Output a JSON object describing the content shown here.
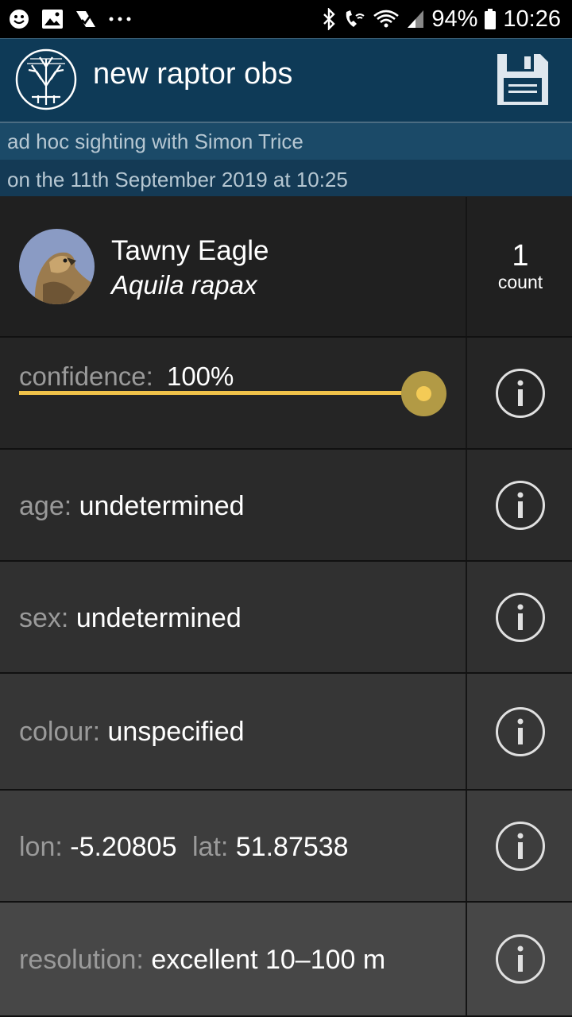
{
  "status_bar": {
    "battery": "94%",
    "time": "10:26",
    "left_icons": [
      "face-icon",
      "image-icon",
      "check-icon",
      "more-icon"
    ],
    "right_icons": [
      "bluetooth-icon",
      "wifi-call-icon",
      "wifi-icon",
      "signal-icon",
      "battery-icon"
    ]
  },
  "header": {
    "title": "new raptor obs",
    "logo": "tree-logo-icon",
    "save_icon": "save-icon"
  },
  "subheader": {
    "line1": "ad hoc sighting with Simon Trice",
    "line2": "on the 11th September 2019 at 10:25"
  },
  "species": {
    "common_name": "Tawny Eagle",
    "latin_name": "Aquila rapax",
    "count_value": "1",
    "count_label": "count"
  },
  "confidence": {
    "label": "confidence:",
    "value": "100%",
    "level": 1.0
  },
  "fields": {
    "age": {
      "label": "age:",
      "value": "undetermined"
    },
    "sex": {
      "label": "sex:",
      "value": "undetermined"
    },
    "colour": {
      "label": "colour:",
      "value": "unspecified"
    },
    "location": {
      "lon_label": "lon:",
      "lon_value": "-5.20805",
      "lat_label": "lat:",
      "lat_value": "51.87538"
    },
    "resolution": {
      "label": "resolution:",
      "value": "excellent 10–100 m"
    }
  },
  "colors": {
    "header_bg": "#0e3a57",
    "accent_slider": "#f0c24a",
    "row_bg_1": "#202020",
    "row_bg_last": "#474747"
  }
}
